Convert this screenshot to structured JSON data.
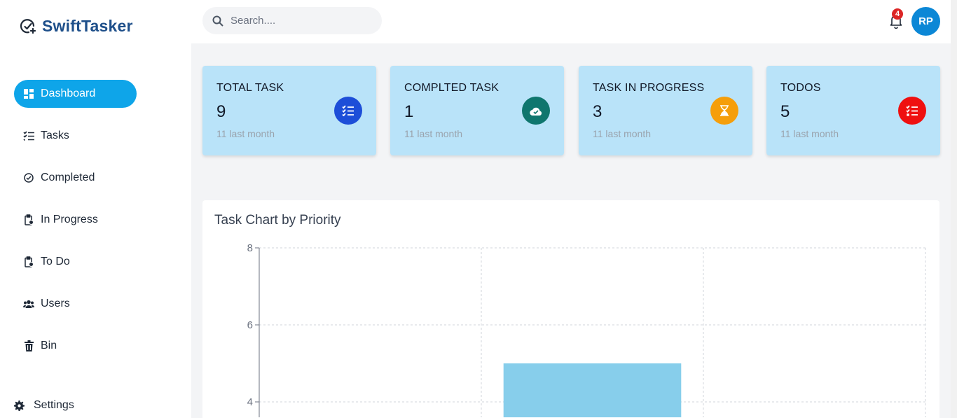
{
  "app": {
    "name": "SwiftTasker"
  },
  "sidebar": {
    "items": [
      {
        "label": "Dashboard",
        "icon": "dashboard-icon",
        "active": true
      },
      {
        "label": "Tasks",
        "icon": "tasks-icon",
        "active": false
      },
      {
        "label": "Completed",
        "icon": "check-circle-icon",
        "active": false
      },
      {
        "label": "In Progress",
        "icon": "clipboard-clock-icon",
        "active": false
      },
      {
        "label": "To Do",
        "icon": "clipboard-clock-icon",
        "active": false
      },
      {
        "label": "Users",
        "icon": "users-icon",
        "active": false
      },
      {
        "label": "Bin",
        "icon": "trash-icon",
        "active": false
      }
    ],
    "settings_label": "Settings"
  },
  "topbar": {
    "search_placeholder": "Search....",
    "notification_count": "4",
    "avatar_initials": "RP"
  },
  "stats": [
    {
      "label": "TOTAL TASK",
      "value": "9",
      "sub": "11 last month",
      "color": "#1d4ed8",
      "icon": "list-check-icon"
    },
    {
      "label": "COMPLTED TASK",
      "value": "1",
      "sub": "11 last month",
      "color": "#0f766e",
      "icon": "cloud-check-icon"
    },
    {
      "label": "TASK IN PROGRESS",
      "value": "3",
      "sub": "11 last month",
      "color": "#f59e0b",
      "icon": "hourglass-icon"
    },
    {
      "label": "TODOS",
      "value": "5",
      "sub": "11 last month",
      "color": "#ef1010",
      "icon": "list-todo-icon"
    }
  ],
  "chart": {
    "title": "Task Chart by Priority"
  },
  "chart_data": {
    "type": "bar",
    "categories": [
      "",
      "",
      ""
    ],
    "values": [
      null,
      5,
      null
    ],
    "ylim": [
      3.6,
      8
    ],
    "yticks": [
      4,
      6,
      8
    ],
    "grid": true,
    "bar_color": "#87ceeb"
  },
  "colors": {
    "accent": "#0ea5e9",
    "brand": "#1e4f8a",
    "card_bg": "#b9e3f9"
  }
}
